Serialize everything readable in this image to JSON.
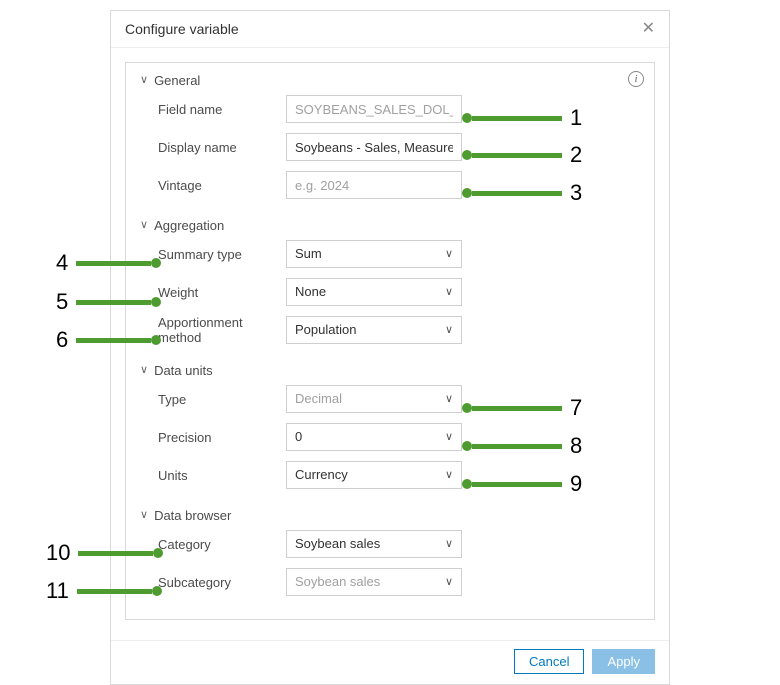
{
  "dialog": {
    "title": "Configure variable",
    "sections": {
      "general": {
        "header": "General",
        "field_name_label": "Field name",
        "field_name_value": "SOYBEANS_SALES_DOL_TOT",
        "display_name_label": "Display name",
        "display_name_value": "Soybeans - Sales, Measured In Dollars - Total",
        "vintage_label": "Vintage",
        "vintage_placeholder": "e.g. 2024"
      },
      "aggregation": {
        "header": "Aggregation",
        "summary_type_label": "Summary type",
        "summary_type_value": "Sum",
        "weight_label": "Weight",
        "weight_value": "None",
        "apportionment_label": "Apportionment method",
        "apportionment_value": "Population"
      },
      "data_units": {
        "header": "Data units",
        "type_label": "Type",
        "type_value": "Decimal",
        "precision_label": "Precision",
        "precision_value": "0",
        "units_label": "Units",
        "units_value": "Currency"
      },
      "data_browser": {
        "header": "Data browser",
        "category_label": "Category",
        "category_value": "Soybean sales",
        "subcategory_label": "Subcategory",
        "subcategory_value": "Soybean sales"
      }
    },
    "footer": {
      "cancel": "Cancel",
      "apply": "Apply"
    }
  },
  "annotations": {
    "n1": "1",
    "n2": "2",
    "n3": "3",
    "n4": "4",
    "n5": "5",
    "n6": "6",
    "n7": "7",
    "n8": "8",
    "n9": "9",
    "n10": "10",
    "n11": "11"
  }
}
